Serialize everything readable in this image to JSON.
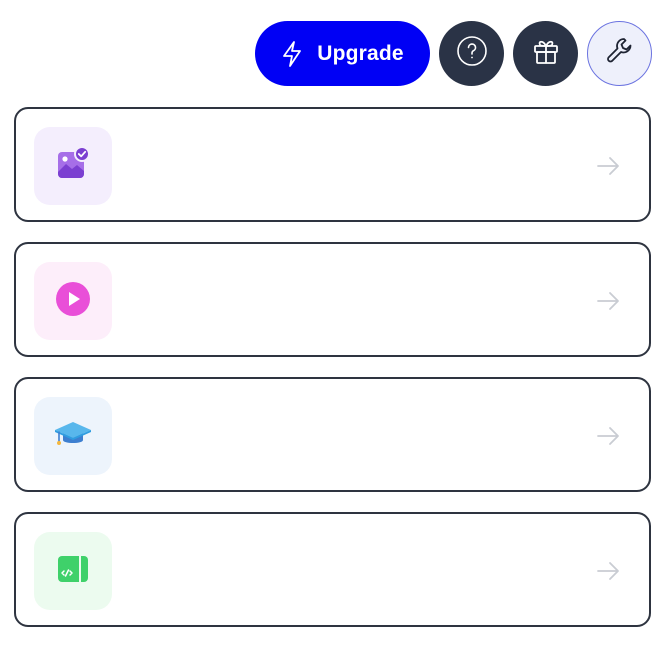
{
  "header": {
    "upgrade_label": "Upgrade",
    "help_icon": "question-circle-icon",
    "gift_icon": "gift-icon",
    "tools_icon": "wrench-icon"
  },
  "colors": {
    "upgrade_bg": "#0000f5",
    "dark_button": "#2a3346",
    "card_border": "#2e3440",
    "image_tile": "#f4eefd",
    "video_tile": "#fdeefa",
    "learn_tile": "#edf4fc",
    "code_tile": "#ecfbef"
  },
  "cards": [
    {
      "icon": "image-check-icon",
      "title": ""
    },
    {
      "icon": "play-circle-icon",
      "title": ""
    },
    {
      "icon": "graduation-cap-icon",
      "title": ""
    },
    {
      "icon": "code-panel-icon",
      "title": ""
    }
  ]
}
